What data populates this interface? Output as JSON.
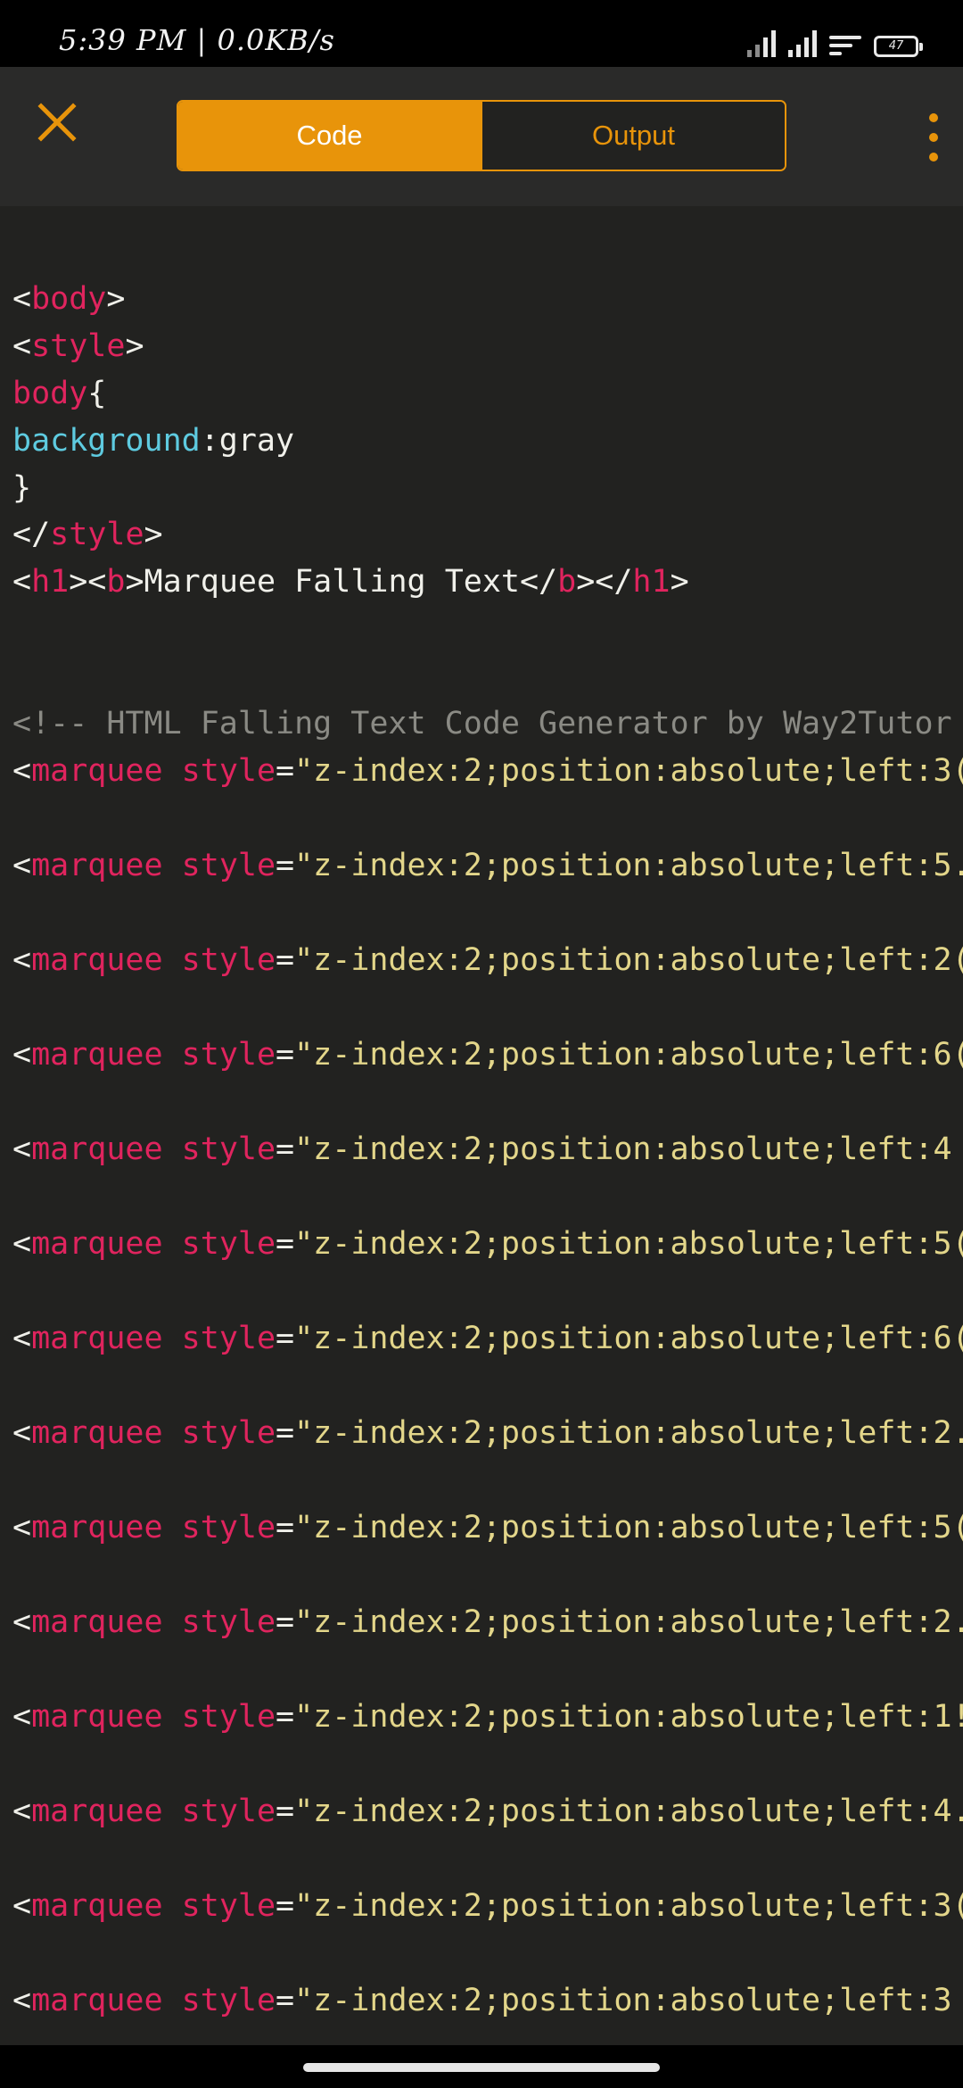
{
  "status_bar": {
    "time": "5:39 PM | 0.0KB/s",
    "battery": "47",
    "icons": [
      "signal-icon",
      "signal-icon",
      "wifi-icon",
      "battery-icon"
    ]
  },
  "app_bar": {
    "close_icon": "close-icon",
    "tabs": [
      {
        "label": "Code",
        "active": true
      },
      {
        "label": "Output",
        "active": false
      }
    ],
    "menu_icon": "more-vertical-icon",
    "accent_color": "#e8940a"
  },
  "editor": {
    "lines": [
      {
        "parts": [
          [
            "punct",
            "<"
          ],
          [
            "tag",
            "body"
          ],
          [
            "punct",
            ">"
          ]
        ]
      },
      {
        "parts": [
          [
            "punct",
            "<"
          ],
          [
            "tag",
            "style"
          ],
          [
            "punct",
            ">"
          ]
        ]
      },
      {
        "parts": [
          [
            "tag",
            "body"
          ],
          [
            "punct",
            "{"
          ]
        ]
      },
      {
        "parts": [
          [
            "prop",
            "background"
          ],
          [
            "punct",
            ":gray"
          ]
        ]
      },
      {
        "parts": [
          [
            "punct",
            "}"
          ]
        ]
      },
      {
        "parts": [
          [
            "punct",
            "</"
          ],
          [
            "tag",
            "style"
          ],
          [
            "punct",
            ">"
          ]
        ]
      },
      {
        "parts": [
          [
            "punct",
            "<"
          ],
          [
            "tag",
            "h1"
          ],
          [
            "punct",
            "><"
          ],
          [
            "tag",
            "b"
          ],
          [
            "punct",
            ">Marquee Falling Text</"
          ],
          [
            "tag",
            "b"
          ],
          [
            "punct",
            "></"
          ],
          [
            "tag",
            "h1"
          ],
          [
            "punct",
            ">"
          ]
        ]
      },
      {
        "parts": [
          [
            "comment",
            "<!-- HTML Falling Text Code Generator by Way2Tutor"
          ]
        ]
      },
      {
        "parts": [
          [
            "punct",
            "<"
          ],
          [
            "tag",
            "marquee"
          ],
          [
            "punct",
            " "
          ],
          [
            "tag",
            "style"
          ],
          [
            "punct",
            "="
          ],
          [
            "str",
            "\"z-index:2;position:absolute;left:3("
          ]
        ]
      },
      {
        "parts": [
          [
            "punct",
            "<"
          ],
          [
            "tag",
            "marquee"
          ],
          [
            "punct",
            " "
          ],
          [
            "tag",
            "style"
          ],
          [
            "punct",
            "="
          ],
          [
            "str",
            "\"z-index:2;position:absolute;left:5."
          ]
        ]
      },
      {
        "parts": [
          [
            "punct",
            "<"
          ],
          [
            "tag",
            "marquee"
          ],
          [
            "punct",
            " "
          ],
          [
            "tag",
            "style"
          ],
          [
            "punct",
            "="
          ],
          [
            "str",
            "\"z-index:2;position:absolute;left:2("
          ]
        ]
      },
      {
        "parts": [
          [
            "punct",
            "<"
          ],
          [
            "tag",
            "marquee"
          ],
          [
            "punct",
            " "
          ],
          [
            "tag",
            "style"
          ],
          [
            "punct",
            "="
          ],
          [
            "str",
            "\"z-index:2;position:absolute;left:6("
          ]
        ]
      },
      {
        "parts": [
          [
            "punct",
            "<"
          ],
          [
            "tag",
            "marquee"
          ],
          [
            "punct",
            " "
          ],
          [
            "tag",
            "style"
          ],
          [
            "punct",
            "="
          ],
          [
            "str",
            "\"z-index:2;position:absolute;left:4"
          ]
        ]
      },
      {
        "parts": [
          [
            "punct",
            "<"
          ],
          [
            "tag",
            "marquee"
          ],
          [
            "punct",
            " "
          ],
          [
            "tag",
            "style"
          ],
          [
            "punct",
            "="
          ],
          [
            "str",
            "\"z-index:2;position:absolute;left:5("
          ]
        ]
      },
      {
        "parts": [
          [
            "punct",
            "<"
          ],
          [
            "tag",
            "marquee"
          ],
          [
            "punct",
            " "
          ],
          [
            "tag",
            "style"
          ],
          [
            "punct",
            "="
          ],
          [
            "str",
            "\"z-index:2;position:absolute;left:6("
          ]
        ]
      },
      {
        "parts": [
          [
            "punct",
            "<"
          ],
          [
            "tag",
            "marquee"
          ],
          [
            "punct",
            " "
          ],
          [
            "tag",
            "style"
          ],
          [
            "punct",
            "="
          ],
          [
            "str",
            "\"z-index:2;position:absolute;left:2."
          ]
        ]
      },
      {
        "parts": [
          [
            "punct",
            "<"
          ],
          [
            "tag",
            "marquee"
          ],
          [
            "punct",
            " "
          ],
          [
            "tag",
            "style"
          ],
          [
            "punct",
            "="
          ],
          [
            "str",
            "\"z-index:2;position:absolute;left:5("
          ]
        ]
      },
      {
        "parts": [
          [
            "punct",
            "<"
          ],
          [
            "tag",
            "marquee"
          ],
          [
            "punct",
            " "
          ],
          [
            "tag",
            "style"
          ],
          [
            "punct",
            "="
          ],
          [
            "str",
            "\"z-index:2;position:absolute;left:2."
          ]
        ]
      },
      {
        "parts": [
          [
            "punct",
            "<"
          ],
          [
            "tag",
            "marquee"
          ],
          [
            "punct",
            " "
          ],
          [
            "tag",
            "style"
          ],
          [
            "punct",
            "="
          ],
          [
            "str",
            "\"z-index:2;position:absolute;left:1!"
          ]
        ]
      },
      {
        "parts": [
          [
            "punct",
            "<"
          ],
          [
            "tag",
            "marquee"
          ],
          [
            "punct",
            " "
          ],
          [
            "tag",
            "style"
          ],
          [
            "punct",
            "="
          ],
          [
            "str",
            "\"z-index:2;position:absolute;left:4."
          ]
        ]
      },
      {
        "parts": [
          [
            "punct",
            "<"
          ],
          [
            "tag",
            "marquee"
          ],
          [
            "punct",
            " "
          ],
          [
            "tag",
            "style"
          ],
          [
            "punct",
            "="
          ],
          [
            "str",
            "\"z-index:2;position:absolute;left:3("
          ]
        ]
      },
      {
        "parts": [
          [
            "punct",
            "<"
          ],
          [
            "tag",
            "marquee"
          ],
          [
            "punct",
            " "
          ],
          [
            "tag",
            "style"
          ],
          [
            "punct",
            "="
          ],
          [
            "str",
            "\"z-index:2;position:absolute;left:3"
          ]
        ]
      }
    ],
    "colors": {
      "background": "#222220",
      "tag": "#e0245e",
      "property": "#5ecbe0",
      "string": "#e3d68a",
      "comment": "#8a8a84",
      "text": "#f0f0ea"
    }
  }
}
